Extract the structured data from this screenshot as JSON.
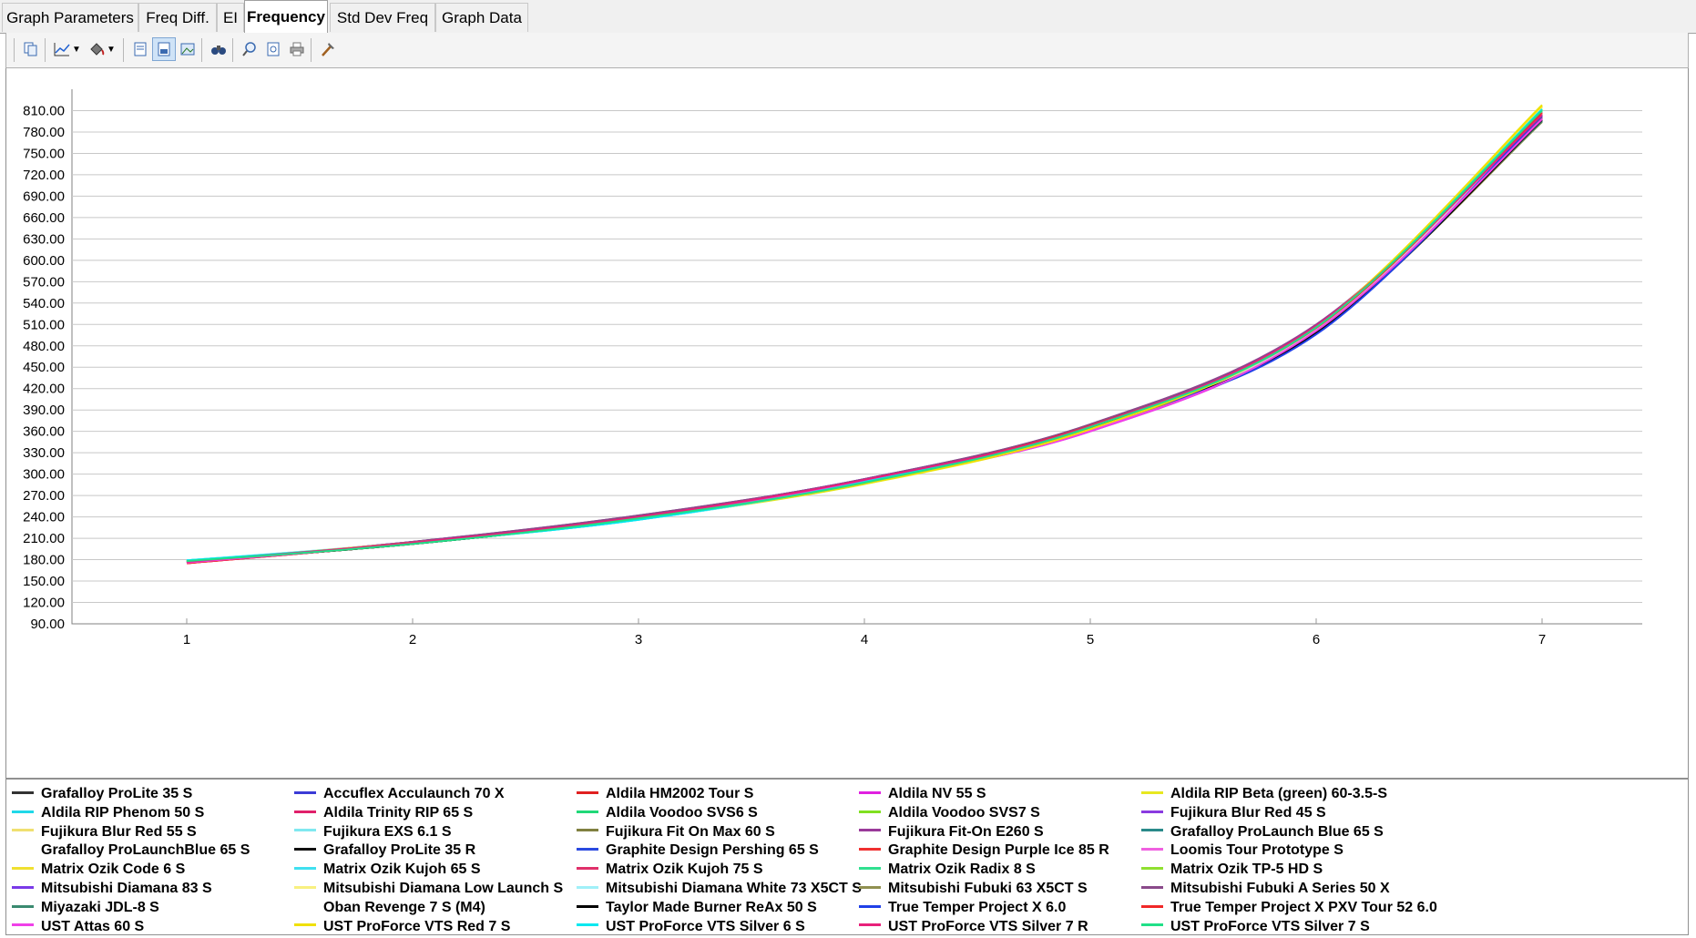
{
  "tabs": [
    {
      "label": "Graph Parameters",
      "active": false
    },
    {
      "label": "Freq Diff.",
      "active": false
    },
    {
      "label": "EI",
      "active": false
    },
    {
      "label": "Frequency",
      "active": true
    },
    {
      "label": "Std Dev Freq",
      "active": false
    },
    {
      "label": "Graph Data",
      "active": false
    }
  ],
  "toolbar": {
    "icons": [
      "copy-icon",
      "chart-type-icon",
      "chart-type-dropdown-icon",
      "fill-color-icon",
      "fill-color-dropdown-icon",
      "page-view-icon",
      "data-view-icon",
      "image-view-icon",
      "binoculars-icon",
      "zoom-icon",
      "print-preview-icon",
      "print-icon",
      "tools-icon"
    ]
  },
  "chart_data": {
    "type": "line",
    "title": "",
    "xlabel": "",
    "ylabel": "",
    "x": [
      1,
      2,
      3,
      4,
      5,
      6,
      7
    ],
    "x_ticks": [
      "1",
      "2",
      "3",
      "4",
      "5",
      "6",
      "7"
    ],
    "y_ticks": [
      "90.00",
      "120.00",
      "150.00",
      "180.00",
      "210.00",
      "240.00",
      "270.00",
      "300.00",
      "330.00",
      "360.00",
      "390.00",
      "420.00",
      "450.00",
      "480.00",
      "510.00",
      "540.00",
      "570.00",
      "600.00",
      "630.00",
      "660.00",
      "690.00",
      "720.00",
      "750.00",
      "780.00",
      "810.00"
    ],
    "ylim": [
      90,
      840
    ],
    "grid": true,
    "legend_position": "bottom",
    "series": [
      {
        "name": "Grafalloy ProLite 35 S",
        "color": "#333333",
        "values": [
          177,
          202,
          238,
          289,
          366,
          500,
          800
        ]
      },
      {
        "name": "Accuflex Acculaunch 70 X",
        "color": "#3b3bd6",
        "values": [
          176,
          204,
          239,
          292,
          368,
          498,
          805
        ]
      },
      {
        "name": "Aldila HM2002 Tour S",
        "color": "#e02020",
        "values": [
          175,
          203,
          240,
          291,
          369,
          505,
          808
        ]
      },
      {
        "name": "Aldila NV 55 S",
        "color": "#e020e0",
        "values": [
          176,
          203,
          239,
          290,
          360,
          500,
          800
        ]
      },
      {
        "name": "Aldila RIP Beta (green) 60-3.5-S",
        "color": "#e8e820",
        "values": [
          178,
          204,
          237,
          286,
          363,
          507,
          818
        ]
      },
      {
        "name": "Aldila RIP Phenom 50 S",
        "color": "#20d8e8",
        "values": [
          179,
          203,
          236,
          289,
          367,
          505,
          812
        ]
      },
      {
        "name": "Aldila Trinity RIP 65 S",
        "color": "#e0206a",
        "values": [
          177,
          204,
          240,
          292,
          367,
          508,
          803
        ]
      },
      {
        "name": "Aldila Voodoo SVS6  S",
        "color": "#20d878",
        "values": [
          178,
          202,
          238,
          288,
          366,
          506,
          810
        ]
      },
      {
        "name": "Aldila Voodoo SVS7 S",
        "color": "#80e020",
        "values": [
          178,
          203,
          237,
          287,
          365,
          505,
          812
        ]
      },
      {
        "name": "Fujikura Blur Red 45 S",
        "color": "#8a3ae0",
        "values": [
          176,
          205,
          241,
          293,
          369,
          509,
          805
        ]
      },
      {
        "name": "Fujikura Blur Red 55 S",
        "color": "#f0e070",
        "values": [
          177,
          203,
          238,
          289,
          364,
          502,
          815
        ]
      },
      {
        "name": "Fujikura EXS 6.1 S",
        "color": "#80e8f0",
        "values": [
          179,
          204,
          236,
          288,
          368,
          506,
          810
        ]
      },
      {
        "name": "Fujikura Fit On Max 60 S",
        "color": "#808040",
        "values": [
          177,
          202,
          239,
          290,
          364,
          500,
          795
        ]
      },
      {
        "name": "Fujikura Fit-On E260 S",
        "color": "#9a3a9a",
        "values": [
          176,
          205,
          242,
          293,
          370,
          510,
          802
        ]
      },
      {
        "name": "Grafalloy ProLaunch Blue 65 S",
        "color": "#2a8a8a",
        "values": [
          178,
          203,
          238,
          289,
          366,
          504,
          796
        ]
      },
      {
        "name": "Grafalloy ProLaunchBlue 65 S",
        "color": "#ffffff",
        "values": [
          178,
          203,
          238,
          289,
          366,
          503,
          806
        ]
      },
      {
        "name": "Grafalloy ProLite 35 R",
        "color": "#111111",
        "values": [
          177,
          202,
          238,
          290,
          366,
          499,
          798
        ]
      },
      {
        "name": "Graphite Design Pershing 65 S",
        "color": "#2a4ae0",
        "values": [
          176,
          203,
          239,
          291,
          367,
          497,
          804
        ]
      },
      {
        "name": "Graphite Design Purple Ice 85 R",
        "color": "#f03030",
        "values": [
          175,
          203,
          240,
          291,
          368,
          506,
          806
        ]
      },
      {
        "name": "Loomis Tour Prototype S",
        "color": "#f060e0",
        "values": [
          176,
          203,
          239,
          290,
          361,
          502,
          799
        ]
      },
      {
        "name": "Matrix Ozik Code 6 S",
        "color": "#f0e030",
        "values": [
          178,
          204,
          237,
          287,
          364,
          506,
          816
        ]
      },
      {
        "name": "Matrix Ozik Kujoh 65 S",
        "color": "#40e0f0",
        "values": [
          179,
          203,
          236,
          288,
          368,
          506,
          811
        ]
      },
      {
        "name": "Matrix Ozik Kujoh 75 S",
        "color": "#e0306a",
        "values": [
          177,
          204,
          240,
          292,
          367,
          507,
          803
        ]
      },
      {
        "name": "Matrix Ozik Radix 8 S",
        "color": "#30e090",
        "values": [
          178,
          202,
          238,
          288,
          366,
          505,
          809
        ]
      },
      {
        "name": "Matrix Ozik TP-5 HD S",
        "color": "#90e030",
        "values": [
          178,
          203,
          237,
          287,
          365,
          504,
          811
        ]
      },
      {
        "name": "Mitsubishi Diamana 83 S",
        "color": "#7a3ae8",
        "values": [
          176,
          205,
          241,
          293,
          369,
          508,
          804
        ]
      },
      {
        "name": "Mitsubishi Diamana Low Launch S",
        "color": "#f8f080",
        "values": [
          177,
          203,
          238,
          289,
          364,
          501,
          814
        ]
      },
      {
        "name": "Mitsubishi Diamana White 73 X5CT S",
        "color": "#a0f0f8",
        "values": [
          179,
          204,
          236,
          288,
          368,
          505,
          809
        ]
      },
      {
        "name": "Mitsubishi Fubuki 63 X5CT S",
        "color": "#909050",
        "values": [
          177,
          202,
          239,
          290,
          364,
          499,
          794
        ]
      },
      {
        "name": "Mitsubishi Fubuki A Series 50 X",
        "color": "#8a4a8a",
        "values": [
          176,
          205,
          242,
          293,
          370,
          509,
          801
        ]
      },
      {
        "name": "Miyazaki JDL-8 S",
        "color": "#3a8a70",
        "values": [
          178,
          203,
          238,
          289,
          366,
          503,
          795
        ]
      },
      {
        "name": "Oban Revenge 7 S (M4)",
        "color": "#ffffff",
        "values": [
          178,
          203,
          238,
          289,
          366,
          503,
          805
        ]
      },
      {
        "name": "Taylor Made Burner ReAx 50 S",
        "color": "#000000",
        "values": [
          177,
          202,
          238,
          290,
          366,
          498,
          797
        ]
      },
      {
        "name": "True Temper Project X 6.0",
        "color": "#2040e8",
        "values": [
          176,
          203,
          239,
          291,
          367,
          496,
          803
        ]
      },
      {
        "name": "True Temper Project X PXV Tour 52 6.0",
        "color": "#f02828",
        "values": [
          175,
          203,
          240,
          291,
          368,
          505,
          807
        ]
      },
      {
        "name": "UST Attas 60 S",
        "color": "#f040e8",
        "values": [
          176,
          203,
          239,
          290,
          360,
          501,
          798
        ]
      },
      {
        "name": "UST ProForce VTS Red 7 S",
        "color": "#f0e000",
        "values": [
          178,
          204,
          237,
          287,
          363,
          507,
          817
        ]
      },
      {
        "name": "UST ProForce VTS Silver 6 S",
        "color": "#00e8f0",
        "values": [
          179,
          203,
          236,
          289,
          367,
          506,
          812
        ]
      },
      {
        "name": "UST ProForce VTS Silver 7 R",
        "color": "#e8207a",
        "values": [
          177,
          204,
          240,
          292,
          367,
          508,
          804
        ]
      },
      {
        "name": "UST ProForce VTS Silver 7 S",
        "color": "#20e088",
        "values": [
          178,
          202,
          238,
          288,
          366,
          506,
          810
        ]
      }
    ]
  }
}
